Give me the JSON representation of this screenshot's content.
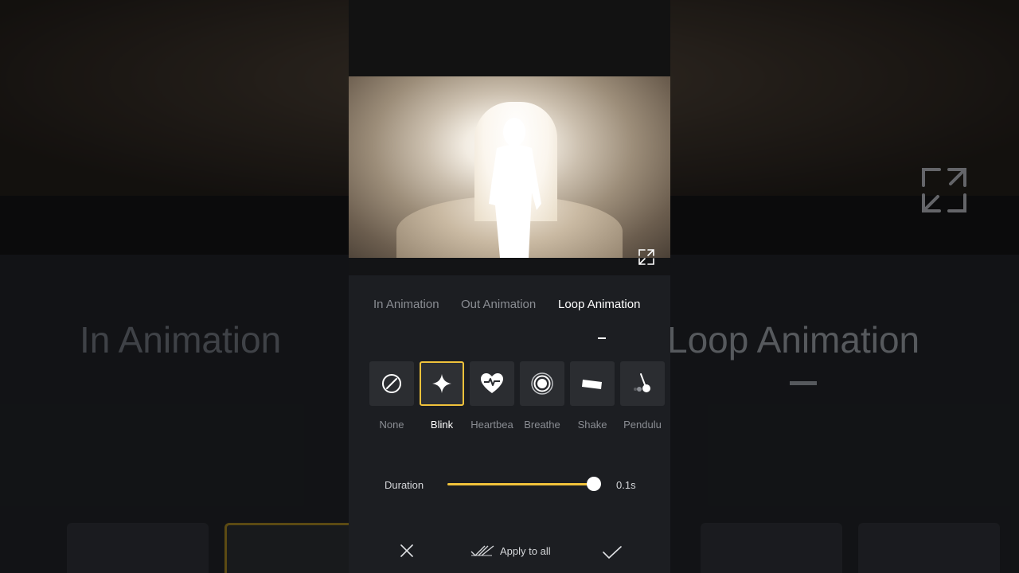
{
  "background": {
    "tabs": [
      "In Animation",
      "Loop Animation"
    ]
  },
  "preview": {
    "expand_icon": "fullscreen-expand-icon"
  },
  "tabs": [
    {
      "label": "In Animation",
      "active": false
    },
    {
      "label": "Out Animation",
      "active": false
    },
    {
      "label": "Loop Animation",
      "active": true
    }
  ],
  "animations": [
    {
      "label": "None",
      "icon": "none-icon",
      "selected": false
    },
    {
      "label": "Blink",
      "icon": "sparkle-icon",
      "selected": true
    },
    {
      "label": "Heartbea",
      "icon": "heartbeat-icon",
      "selected": false
    },
    {
      "label": "Breathe",
      "icon": "breathe-icon",
      "selected": false
    },
    {
      "label": "Shake",
      "icon": "shake-icon",
      "selected": false
    },
    {
      "label": "Pendulu",
      "icon": "pendulum-icon",
      "selected": false
    }
  ],
  "duration": {
    "label": "Duration",
    "value": "0.1s",
    "slider_fraction": 1.0
  },
  "actions": {
    "cancel_icon": "close-icon",
    "apply_all_label": "Apply to all",
    "confirm_icon": "check-icon"
  },
  "colors": {
    "accent": "#f0c23b",
    "panel": "#1c1e22",
    "tile": "#2b2d31"
  }
}
